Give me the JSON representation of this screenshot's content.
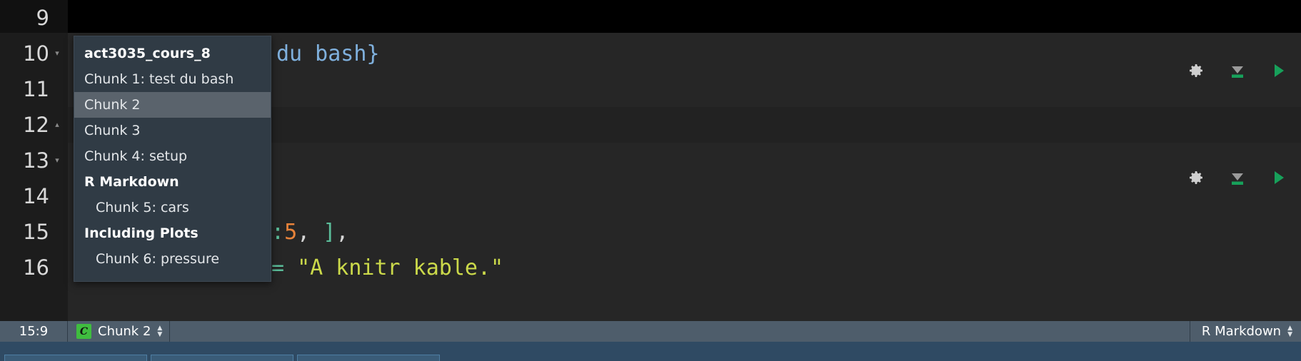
{
  "editor": {
    "gutter_lines": [
      {
        "number": "9",
        "fold": ""
      },
      {
        "number": "10",
        "fold": "▾"
      },
      {
        "number": "11",
        "fold": ""
      },
      {
        "number": "12",
        "fold": "▴"
      },
      {
        "number": "13",
        "fold": "▾"
      },
      {
        "number": "14",
        "fold": ""
      },
      {
        "number": "15",
        "fold": ""
      },
      {
        "number": "16",
        "fold": ""
      }
    ],
    "code_lines": {
      "line10_tail": "du bash}",
      "line15_tail_colon": ":",
      "line15_tail_num": "5",
      "line15_tail_comma1": ", ",
      "line15_tail_bracket": "]",
      "line15_tail_comma2": ",",
      "line16_eq": "=",
      "line16_str": " \"A knitr kable.\""
    },
    "toolbar": {
      "settings_label": "Chunk options",
      "run_above_label": "Run all chunks above",
      "run_label": "Run current chunk"
    }
  },
  "menu": {
    "items": [
      {
        "label": "act3035_cours_8",
        "kind": "header",
        "selected": false
      },
      {
        "label": "Chunk 1: test du bash",
        "kind": "item",
        "selected": false
      },
      {
        "label": "Chunk 2",
        "kind": "item",
        "selected": true
      },
      {
        "label": "Chunk 3",
        "kind": "item",
        "selected": false
      },
      {
        "label": "Chunk 4: setup",
        "kind": "item",
        "selected": false
      },
      {
        "label": "R Markdown",
        "kind": "section",
        "selected": false
      },
      {
        "label": "Chunk 5: cars",
        "kind": "indent",
        "selected": false
      },
      {
        "label": "Including Plots",
        "kind": "section",
        "selected": false
      },
      {
        "label": "Chunk 6: pressure",
        "kind": "indent",
        "selected": false
      }
    ]
  },
  "statusbar": {
    "cursor_position": "15:9",
    "chunk_badge": "C",
    "chunk_label": "Chunk 2",
    "document_mode": "R Markdown"
  },
  "colors": {
    "editor_background": "#222222",
    "gutter_background": "#1c1c1c",
    "menu_background": "#303b45",
    "menu_selected": "#5a636c",
    "statusbar_background": "#4e5d6b",
    "accent_green": "#3fbd3f",
    "run_green": "#17a05a",
    "string_yellow": "#cbd94a",
    "number_orange": "#e8833a",
    "operator_teal": "#5bbd9a",
    "header_blue": "#7fb0dd"
  }
}
